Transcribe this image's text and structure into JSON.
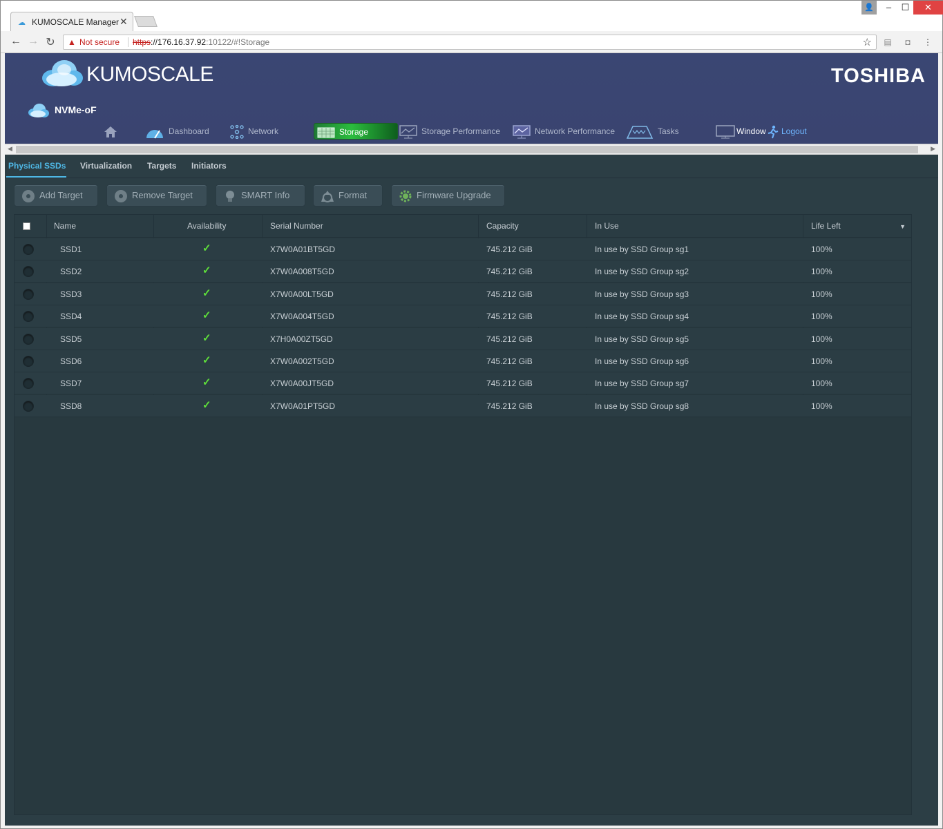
{
  "browser": {
    "tab_title": "KUMOSCALE Manager",
    "security_label": "Not secure",
    "url_scheme": "https",
    "url_host": "://176.16.37.92",
    "url_rest": ":10122/#!Storage"
  },
  "header": {
    "app_name": "KUMOSCALE",
    "brand": "TOSHIBA",
    "section_title": "NVMe-oF"
  },
  "nav": {
    "dashboard": "Dashboard",
    "network": "Network",
    "storage": "Storage",
    "storage_performance": "Storage Performance",
    "network_performance": "Network Performance",
    "tasks": "Tasks",
    "window": "Window",
    "logout": "Logout"
  },
  "subtabs": [
    "Physical SSDs",
    "Virtualization",
    "Targets",
    "Initiators"
  ],
  "toolbar": {
    "add_target": "Add Target",
    "remove_target": "Remove Target",
    "smart_info": "SMART Info",
    "format": "Format",
    "firmware_upgrade": "Firmware Upgrade"
  },
  "table": {
    "columns": [
      "Name",
      "Availability",
      "Serial Number",
      "Capacity",
      "In Use",
      "Life Left"
    ],
    "rows": [
      {
        "name": "SSD1",
        "available": true,
        "serial": "X7W0A01BT5GD",
        "capacity": "745.212 GiB",
        "in_use": "In use by SSD Group sg1",
        "life_left": "100%"
      },
      {
        "name": "SSD2",
        "available": true,
        "serial": "X7W0A008T5GD",
        "capacity": "745.212 GiB",
        "in_use": "In use by SSD Group sg2",
        "life_left": "100%"
      },
      {
        "name": "SSD3",
        "available": true,
        "serial": "X7W0A00LT5GD",
        "capacity": "745.212 GiB",
        "in_use": "In use by SSD Group sg3",
        "life_left": "100%"
      },
      {
        "name": "SSD4",
        "available": true,
        "serial": "X7W0A004T5GD",
        "capacity": "745.212 GiB",
        "in_use": "In use by SSD Group sg4",
        "life_left": "100%"
      },
      {
        "name": "SSD5",
        "available": true,
        "serial": "X7H0A00ZT5GD",
        "capacity": "745.212 GiB",
        "in_use": "In use by SSD Group sg5",
        "life_left": "100%"
      },
      {
        "name": "SSD6",
        "available": true,
        "serial": "X7W0A002T5GD",
        "capacity": "745.212 GiB",
        "in_use": "In use by SSD Group sg6",
        "life_left": "100%"
      },
      {
        "name": "SSD7",
        "available": true,
        "serial": "X7W0A00JT5GD",
        "capacity": "745.212 GiB",
        "in_use": "In use by SSD Group sg7",
        "life_left": "100%"
      },
      {
        "name": "SSD8",
        "available": true,
        "serial": "X7W0A01PT5GD",
        "capacity": "745.212 GiB",
        "in_use": "In use by SSD Group sg8",
        "life_left": "100%"
      }
    ]
  },
  "colors": {
    "header_bg": "#3a4570",
    "content_bg": "#2c3e45",
    "active_nav": "#2bbd3e",
    "active_tab": "#4fb8e6",
    "check": "#5fe23a",
    "logout_link": "#6fb6ff"
  }
}
